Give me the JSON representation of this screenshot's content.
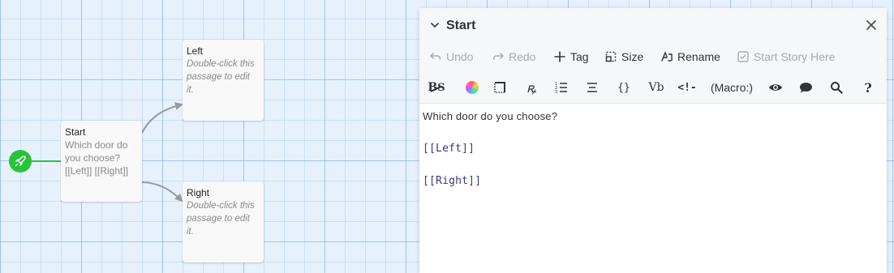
{
  "story_map": {
    "passages": [
      {
        "id": "left",
        "title": "Left",
        "excerpt": "Double-click this passage to edit it.",
        "placeholder": true
      },
      {
        "id": "start",
        "title": "Start",
        "excerpt": "Which door do you choose? [[Left]] [[Right]]",
        "placeholder": false
      },
      {
        "id": "right",
        "title": "Right",
        "excerpt": "Double-click this passage to edit it.",
        "placeholder": true
      }
    ],
    "start_marker_icon": "rocket-icon"
  },
  "dialog": {
    "title": "Start",
    "collapse_icon": "chevron-down-icon",
    "close_icon": "close-icon",
    "toolbar": {
      "undo": "Undo",
      "redo": "Redo",
      "tag": "Tag",
      "size": "Size",
      "rename": "Rename",
      "start_story_here": "Start Story Here"
    },
    "format_toolbar": {
      "macro": "(Macro:)",
      "bold_strike_icon": "bold-strike-icon",
      "color_icon": "color-wheel-icon",
      "border_icon": "border-icon",
      "font_icon": "font-style-icon",
      "list_icon": "list-icon",
      "align_icon": "align-icon",
      "braces": "{}",
      "var": "Vb",
      "comment_icon": "comment-brackets-icon",
      "eye_icon": "eye-icon",
      "speech_icon": "speech-bubble-icon",
      "search_icon": "search-icon",
      "help": "?"
    },
    "editor_lines": [
      "Which door do you choose?",
      "[[Left]]",
      "[[Right]]"
    ]
  },
  "colors": {
    "accent_green": "#27c43a",
    "grid_bg": "#e6f1fc"
  }
}
